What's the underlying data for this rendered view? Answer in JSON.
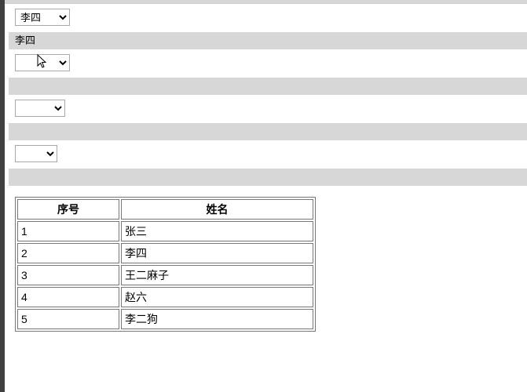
{
  "dropdowns": {
    "d1": {
      "selected": "李四"
    },
    "d2": {
      "selected": ""
    },
    "d3": {
      "selected": ""
    },
    "d4": {
      "selected": ""
    }
  },
  "bands": {
    "b1": "李四",
    "b2": "",
    "b3": "",
    "b4": ""
  },
  "table": {
    "headers": {
      "index": "序号",
      "name": "姓名"
    },
    "rows": [
      {
        "index": "1",
        "name": "张三"
      },
      {
        "index": "2",
        "name": "李四"
      },
      {
        "index": "3",
        "name": "王二麻子"
      },
      {
        "index": "4",
        "name": "赵六"
      },
      {
        "index": "5",
        "name": "李二狗"
      }
    ]
  }
}
